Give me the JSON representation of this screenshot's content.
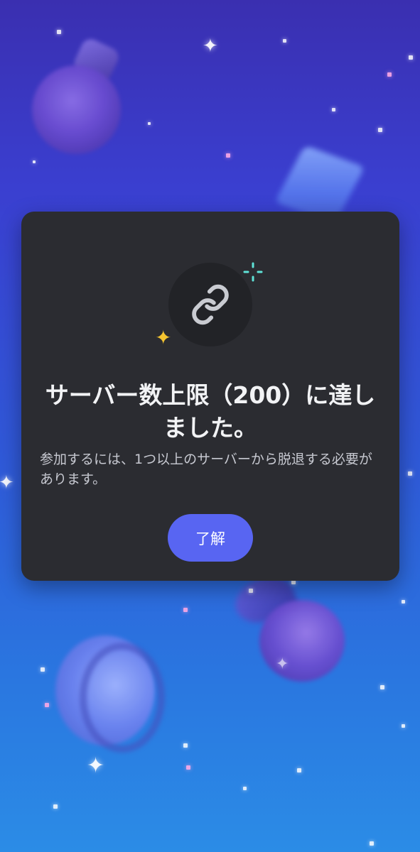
{
  "background": {
    "gradient_top": "#3a2fb0",
    "gradient_bottom": "#2b8ce6"
  },
  "dialog": {
    "icon": "link-icon",
    "title": "サーバー数上限（200）に達しました。",
    "message": "参加するには、1つ以上のサーバーから脱退する必要があります。",
    "button_label": "了解",
    "accent_color": "#5865f2",
    "background_color": "#2b2c31"
  }
}
